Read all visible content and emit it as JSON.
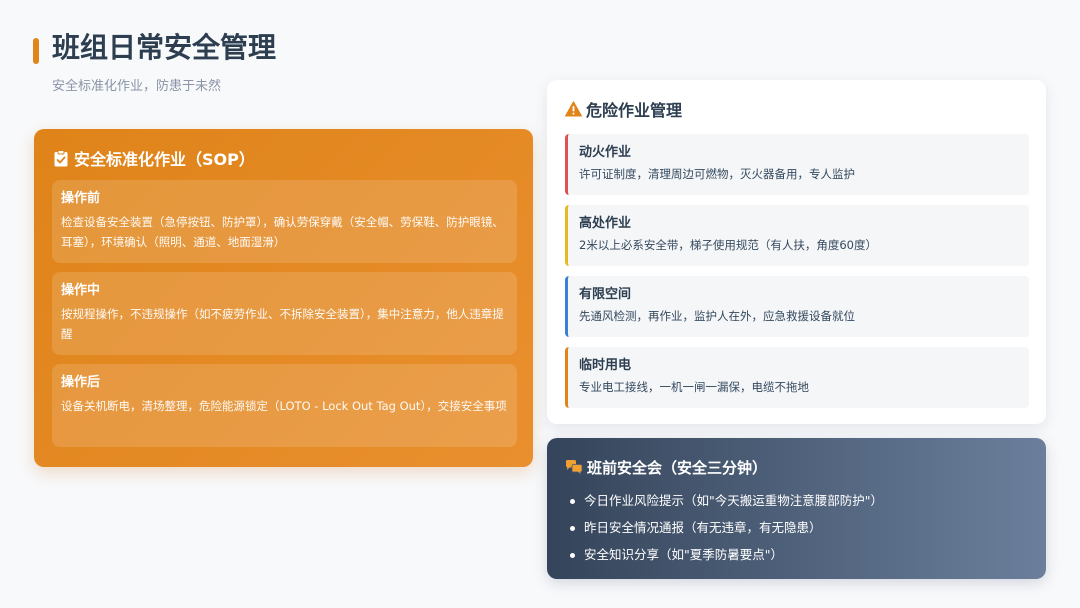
{
  "header": {
    "title": "班组日常安全管理",
    "subtitle": "安全标准化作业，防患于未然"
  },
  "colors": {
    "accent": "#e0851a",
    "text_dark": "#2c3e50",
    "hazard_fire": "#e05050",
    "hazard_height": "#e8b820",
    "hazard_confined": "#3d7fd6",
    "hazard_electric": "#e0851a"
  },
  "sop": {
    "icon": "clipboard-check-icon",
    "title": "安全标准化作业（SOP）",
    "items": [
      {
        "title": "操作前",
        "desc": "检查设备安全装置（急停按钮、防护罩），确认劳保穿戴（安全帽、劳保鞋、防护眼镜、耳塞），环境确认（照明、通道、地面湿滑）"
      },
      {
        "title": "操作中",
        "desc": "按规程操作，不违规操作（如不疲劳作业、不拆除安全装置），集中注意力，他人违章提醒"
      },
      {
        "title": "操作后",
        "desc": "设备关机断电，清场整理，危险能源锁定（LOTO - Lock Out Tag Out），交接安全事项"
      }
    ]
  },
  "hazard": {
    "icon": "warning-triangle-icon",
    "title": "危险作业管理",
    "items": [
      {
        "title": "动火作业",
        "desc": "许可证制度，清理周边可燃物，灭火器备用，专人监护"
      },
      {
        "title": "高处作业",
        "desc": "2米以上必系安全带，梯子使用规范（有人扶，角度60度）"
      },
      {
        "title": "有限空间",
        "desc": "先通风检测，再作业，监护人在外，应急救援设备就位"
      },
      {
        "title": "临时用电",
        "desc": "专业电工接线，一机一闸一漏保，电缆不拖地"
      }
    ]
  },
  "meeting": {
    "icon": "chat-bubbles-icon",
    "title": "班前安全会（安全三分钟）",
    "items": [
      "今日作业风险提示（如\"今天搬运重物注意腰部防护\"）",
      "昨日安全情况通报（有无违章，有无隐患）",
      "安全知识分享（如\"夏季防暑要点\"）"
    ]
  }
}
